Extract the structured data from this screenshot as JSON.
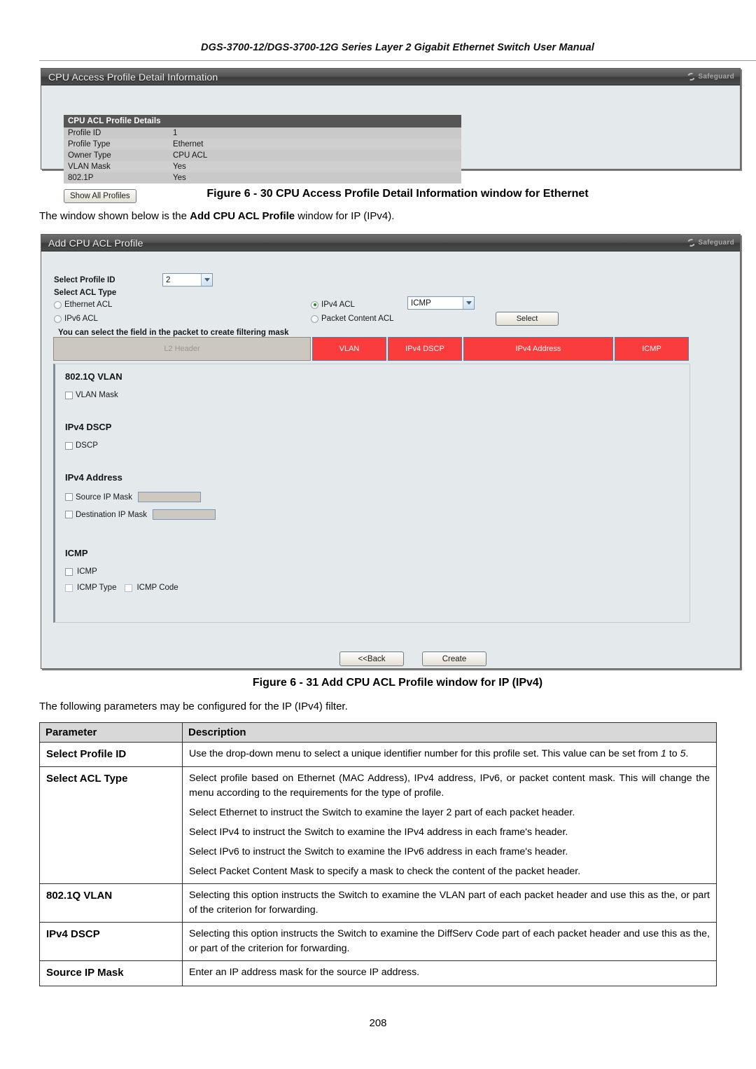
{
  "document": {
    "running_header": "DGS-3700-12/DGS-3700-12G Series Layer 2 Gigabit Ethernet Switch User Manual",
    "page_number": "208"
  },
  "figure_30": {
    "window": {
      "title": "CPU Access Profile Detail Information",
      "safeguard_label": "Safeguard"
    },
    "table": {
      "header": "CPU ACL Profile Details",
      "rows": [
        {
          "key": "Profile ID",
          "value": "1"
        },
        {
          "key": "Profile Type",
          "value": "Ethernet"
        },
        {
          "key": "Owner Type",
          "value": "CPU ACL"
        },
        {
          "key": "VLAN Mask",
          "value": "Yes"
        },
        {
          "key": "802.1P",
          "value": "Yes"
        }
      ]
    },
    "show_all_button": "Show All Profiles",
    "caption": "Figure 6 - 30 CPU Access Profile Detail Information window for Ethernet"
  },
  "intro_paragraph": {
    "before": "The window shown below is the ",
    "bold": "Add CPU ACL Profile",
    "after": " window for IP (IPv4)."
  },
  "figure_31": {
    "window": {
      "title": "Add CPU ACL Profile",
      "safeguard_label": "Safeguard"
    },
    "form": {
      "select_profile_id_label": "Select Profile ID",
      "select_profile_id_value": "2",
      "select_acl_type_label": "Select ACL Type",
      "radios": [
        {
          "label": "Ethernet ACL",
          "selected": false
        },
        {
          "label": "IPv6 ACL",
          "selected": false
        },
        {
          "label": "IPv4 ACL",
          "selected": true
        },
        {
          "label": "Packet Content ACL",
          "selected": false
        }
      ],
      "protocol_dropdown_value": "ICMP",
      "select_button": "Select",
      "hint": "You can select the field in the packet to create filtering mask"
    },
    "mask_segments": [
      {
        "label": "L2 Header",
        "state": "disabled"
      },
      {
        "label": "VLAN",
        "state": "active"
      },
      {
        "label": "IPv4 DSCP",
        "state": "active"
      },
      {
        "label": "IPv4 Address",
        "state": "active"
      },
      {
        "label": "ICMP",
        "state": "active"
      }
    ],
    "sections": {
      "vlan": {
        "title": "802.1Q VLAN",
        "checkbox_label": "VLAN Mask"
      },
      "dscp": {
        "title": "IPv4 DSCP",
        "checkbox_label": "DSCP"
      },
      "ipv4": {
        "title": "IPv4 Address",
        "source_label": "Source IP Mask",
        "source_value": "",
        "destination_label": "Destination IP Mask",
        "destination_value": ""
      },
      "icmp": {
        "title": "ICMP",
        "checkbox_label": "ICMP",
        "type_label": "ICMP Type",
        "code_label": "ICMP Code"
      }
    },
    "buttons": {
      "back": "<<Back",
      "create": "Create"
    },
    "caption": "Figure 6 - 31 Add CPU ACL Profile window for IP (IPv4)"
  },
  "params_intro": "The following parameters may be configured for the IP (IPv4) filter.",
  "params_table": {
    "headers": [
      "Parameter",
      "Description"
    ],
    "rows": [
      {
        "name": "Select Profile ID",
        "desc": [
          "Use the drop-down menu to select a unique identifier number for this profile set. This value can be set from <em>1</em> to <em>5</em>."
        ]
      },
      {
        "name": "Select ACL Type",
        "desc": [
          "Select profile based on Ethernet (MAC Address), IPv4 address, IPv6, or packet content mask. This will change the menu according to the requirements for the type of profile.",
          "Select Ethernet to instruct the Switch to examine the layer 2 part of each packet header.",
          "Select IPv4 to instruct the Switch to examine the IPv4 address in each frame's header.",
          "Select IPv6 to instruct the Switch to examine the IPv6 address in each frame's header.",
          "Select Packet Content Mask to specify a mask to check the content of the packet header."
        ]
      },
      {
        "name": "802.1Q VLAN",
        "desc": [
          "Selecting this option instructs the Switch to examine the VLAN part of each packet header and use this as the, or part of the criterion for forwarding."
        ]
      },
      {
        "name": "IPv4 DSCP",
        "desc": [
          "Selecting this option instructs the Switch to examine the DiffServ Code part of each packet header and use this as the, or part of the criterion for forwarding."
        ]
      },
      {
        "name": "Source IP Mask",
        "desc": [
          "Enter an IP address mask for the source IP address."
        ]
      }
    ]
  }
}
